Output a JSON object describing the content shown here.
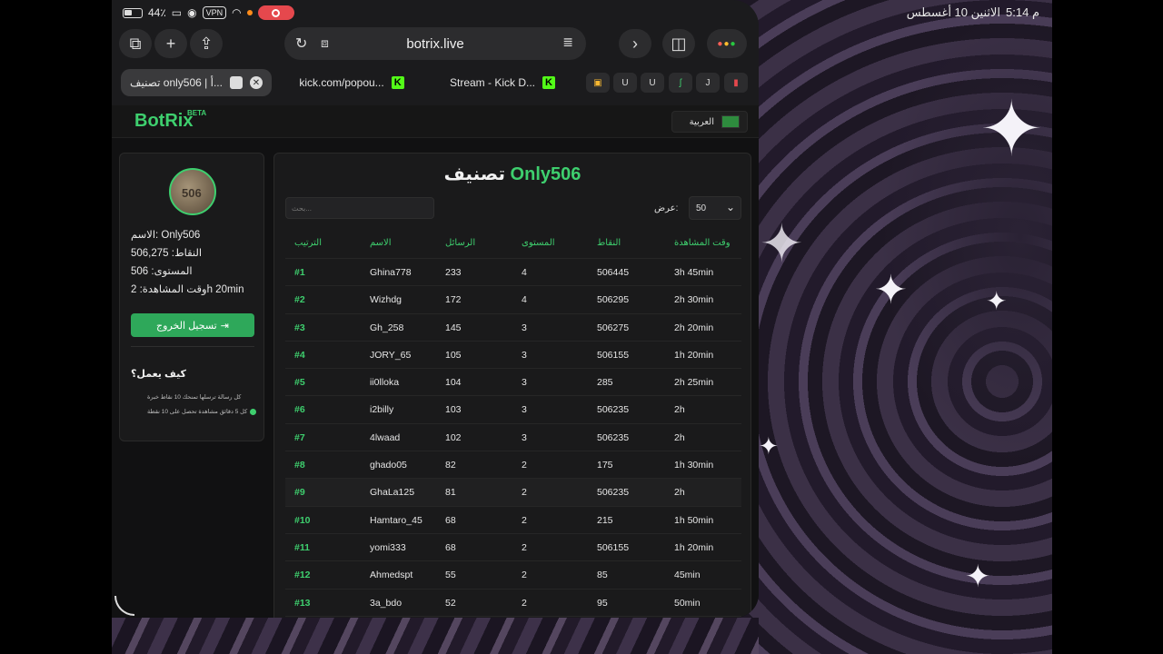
{
  "status_bar": {
    "time": "5:14 م",
    "date": "الاثنين 10 أغسطس",
    "battery": "44٪",
    "vpn": "VPN"
  },
  "browser": {
    "url": "botrix.live",
    "tabs": [
      {
        "label": "تصنيف only506 | أ...",
        "active": true
      },
      {
        "label": "kick.com/popou...",
        "active": false
      },
      {
        "label": "Stream - Kick D...",
        "active": false
      }
    ],
    "favorites": [
      "U",
      "U",
      "J"
    ]
  },
  "site": {
    "logo": "BotRix",
    "beta": "BETA",
    "language": "العربية"
  },
  "profile": {
    "name_line": "الاسم: Only506",
    "points_line": "النقاط: 506,275",
    "level_line": "المستوى: 506",
    "watch_line": "وقت المشاهدة: 2h 20min",
    "logout_label": "تسجيل الخروج",
    "how_title": "كيف يعمل؟",
    "how_line1": "كل رسالة ترسلها تمنحك 10 نقاط خبرة",
    "how_line2": "كل 5 دقائق مشاهدة تحصل على 10 نقطة",
    "avatar_text": "506"
  },
  "leaderboard": {
    "title_prefix": "تصنيف",
    "title_name": "Only506",
    "search_placeholder": "بحث...",
    "show_label": "عرض:",
    "show_value": "50",
    "columns": [
      "الترتيب",
      "الاسم",
      "الرسائل",
      "المستوى",
      "النقاط",
      "وقت المشاهدة"
    ],
    "rows": [
      [
        "#1",
        "Ghina778",
        "233",
        "4",
        "506445",
        "3h 45min"
      ],
      [
        "#2",
        "Wizhdg",
        "172",
        "4",
        "506295",
        "2h 30min"
      ],
      [
        "#3",
        "Gh_258",
        "145",
        "3",
        "506275",
        "2h 20min"
      ],
      [
        "#4",
        "JORY_65",
        "105",
        "3",
        "506155",
        "1h 20min"
      ],
      [
        "#5",
        "ii0lloka",
        "104",
        "3",
        "285",
        "2h 25min"
      ],
      [
        "#6",
        "i2billy",
        "103",
        "3",
        "506235",
        "2h"
      ],
      [
        "#7",
        "4lwaad",
        "102",
        "3",
        "506235",
        "2h"
      ],
      [
        "#8",
        "ghado05",
        "82",
        "2",
        "175",
        "1h 30min"
      ],
      [
        "#9",
        "GhaLa125",
        "81",
        "2",
        "506235",
        "2h"
      ],
      [
        "#10",
        "Hamtaro_45",
        "68",
        "2",
        "215",
        "1h 50min"
      ],
      [
        "#11",
        "yomi333",
        "68",
        "2",
        "506155",
        "1h 20min"
      ],
      [
        "#12",
        "Ahmedspt",
        "55",
        "2",
        "85",
        "45min"
      ],
      [
        "#13",
        "3a_bdo",
        "52",
        "2",
        "95",
        "50min"
      ]
    ],
    "highlight_row": 9
  }
}
